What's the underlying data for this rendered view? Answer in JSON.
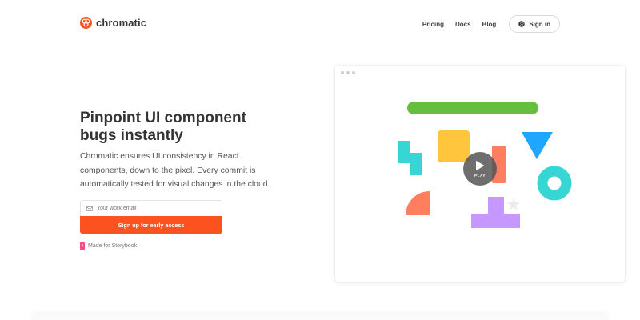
{
  "header": {
    "brand": "chromatic",
    "brand_color": "#fc521f",
    "nav": [
      {
        "label": "Pricing"
      },
      {
        "label": "Docs"
      },
      {
        "label": "Blog"
      }
    ],
    "signin_label": "Sign in",
    "signin_icon": "github-icon"
  },
  "hero": {
    "headline": "Pinpoint UI component bugs instantly",
    "subtext": "Chromatic ensures UI consistency in React components, down to the pixel. Every commit is automatically tested for visual changes in the cloud.",
    "email_placeholder": "Your work email",
    "email_value": "",
    "cta_label": "Sign up for early access",
    "made_for": "Made for Storybook",
    "cta_color": "#fc521f"
  },
  "video": {
    "play_label": "PLAY",
    "shape_colors": {
      "green": "#66bf3c",
      "yellow": "#ffc53d",
      "teal": "#37d5d3",
      "blue": "#1ea7fd",
      "orange": "#ff7e5f",
      "purple": "#c597ff"
    }
  }
}
